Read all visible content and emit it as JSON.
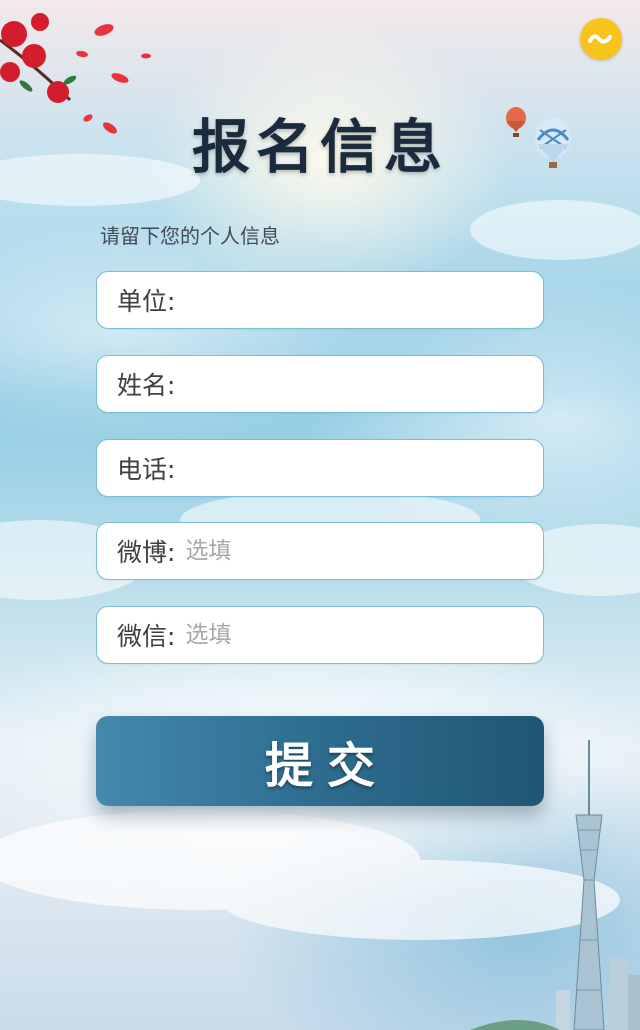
{
  "header": {
    "title": "报名信息",
    "subtitle": "请留下您的个人信息"
  },
  "form": {
    "fields": [
      {
        "label": "单位:",
        "placeholder": ""
      },
      {
        "label": "姓名:",
        "placeholder": ""
      },
      {
        "label": "电话:",
        "placeholder": ""
      },
      {
        "label": "微博:",
        "placeholder": "选填"
      },
      {
        "label": "微信:",
        "placeholder": "选填"
      }
    ],
    "submit_label": "提交"
  },
  "icons": {
    "logo": "infinity-logo-icon",
    "flowers": "red-blossom-branch-icon",
    "balloons": "hot-air-balloon-icon",
    "tower": "city-tower-skyline-icon"
  },
  "colors": {
    "logo_yellow": "#f8c31c",
    "title_dark": "#1b2b3e",
    "title_accent": "#2d6d94",
    "field_border": "#7fbcd8",
    "button_start": "#4489ad",
    "button_end": "#1f5674"
  }
}
